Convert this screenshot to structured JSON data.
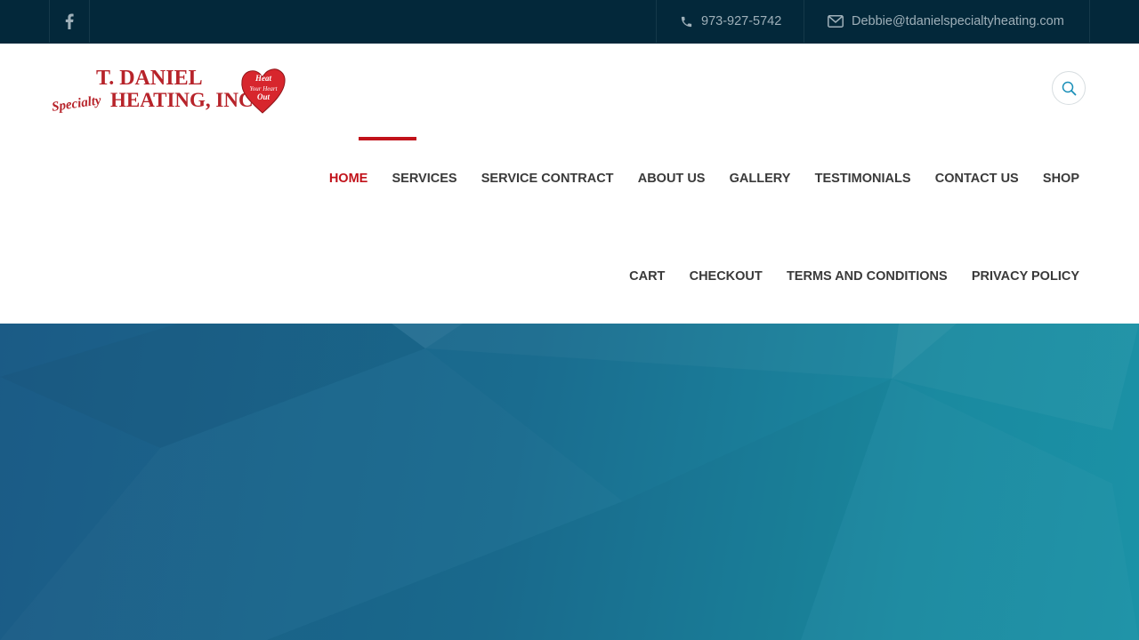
{
  "topbar": {
    "facebook_icon": "facebook-icon",
    "phone": "973-927-5742",
    "email": "Debbie@tdanielspecialtyheating.com"
  },
  "logo": {
    "line1": "T. DANIEL",
    "script": "Specialty",
    "line2": "HEATING, INC.",
    "heart_text": [
      "Heat",
      "Your Heart",
      "Out"
    ],
    "heart_color": "#d7262d",
    "text_color": "#b7232a"
  },
  "nav": {
    "row1": [
      "HOME",
      "SERVICES",
      "SERVICE CONTRACT",
      "ABOUT US",
      "GALLERY",
      "TESTIMONIALS",
      "CONTACT US",
      "SHOP"
    ],
    "row2": [
      "CART",
      "CHECKOUT",
      "TERMS AND CONDITIONS",
      "PRIVACY POLICY"
    ],
    "active": "HOME",
    "accent_color": "#c1121a"
  },
  "hero": {
    "gradient": [
      "#1b5b86",
      "#1b92a6"
    ]
  }
}
